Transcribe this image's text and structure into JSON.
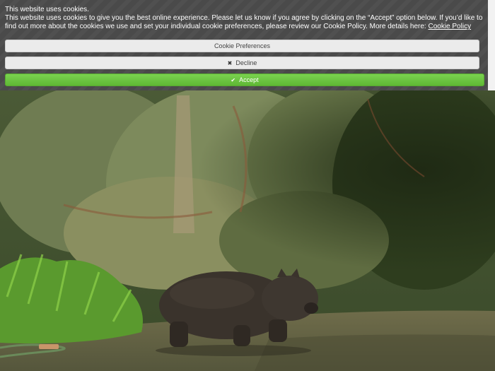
{
  "cookie_banner": {
    "title": "This website uses cookies.",
    "body": "This website uses cookies to give you the best online experience. Please let us know if you agree by clicking on the “Accept” option below. If you’d like to find out more about the cookies we use and set your individual cookie preferences, please review our Cookie Policy. More details here:",
    "policy_link": "Cookie Policy",
    "buttons": {
      "preferences": "Cookie Preferences",
      "decline": "Decline",
      "accept": "Accept"
    },
    "icons": {
      "decline": "close-icon",
      "accept": "checkmark-icon"
    },
    "colors": {
      "banner_bg": "#4a4a4a",
      "accept_bg": "#6cc441",
      "neutral_btn_bg": "#ebebeb"
    }
  }
}
